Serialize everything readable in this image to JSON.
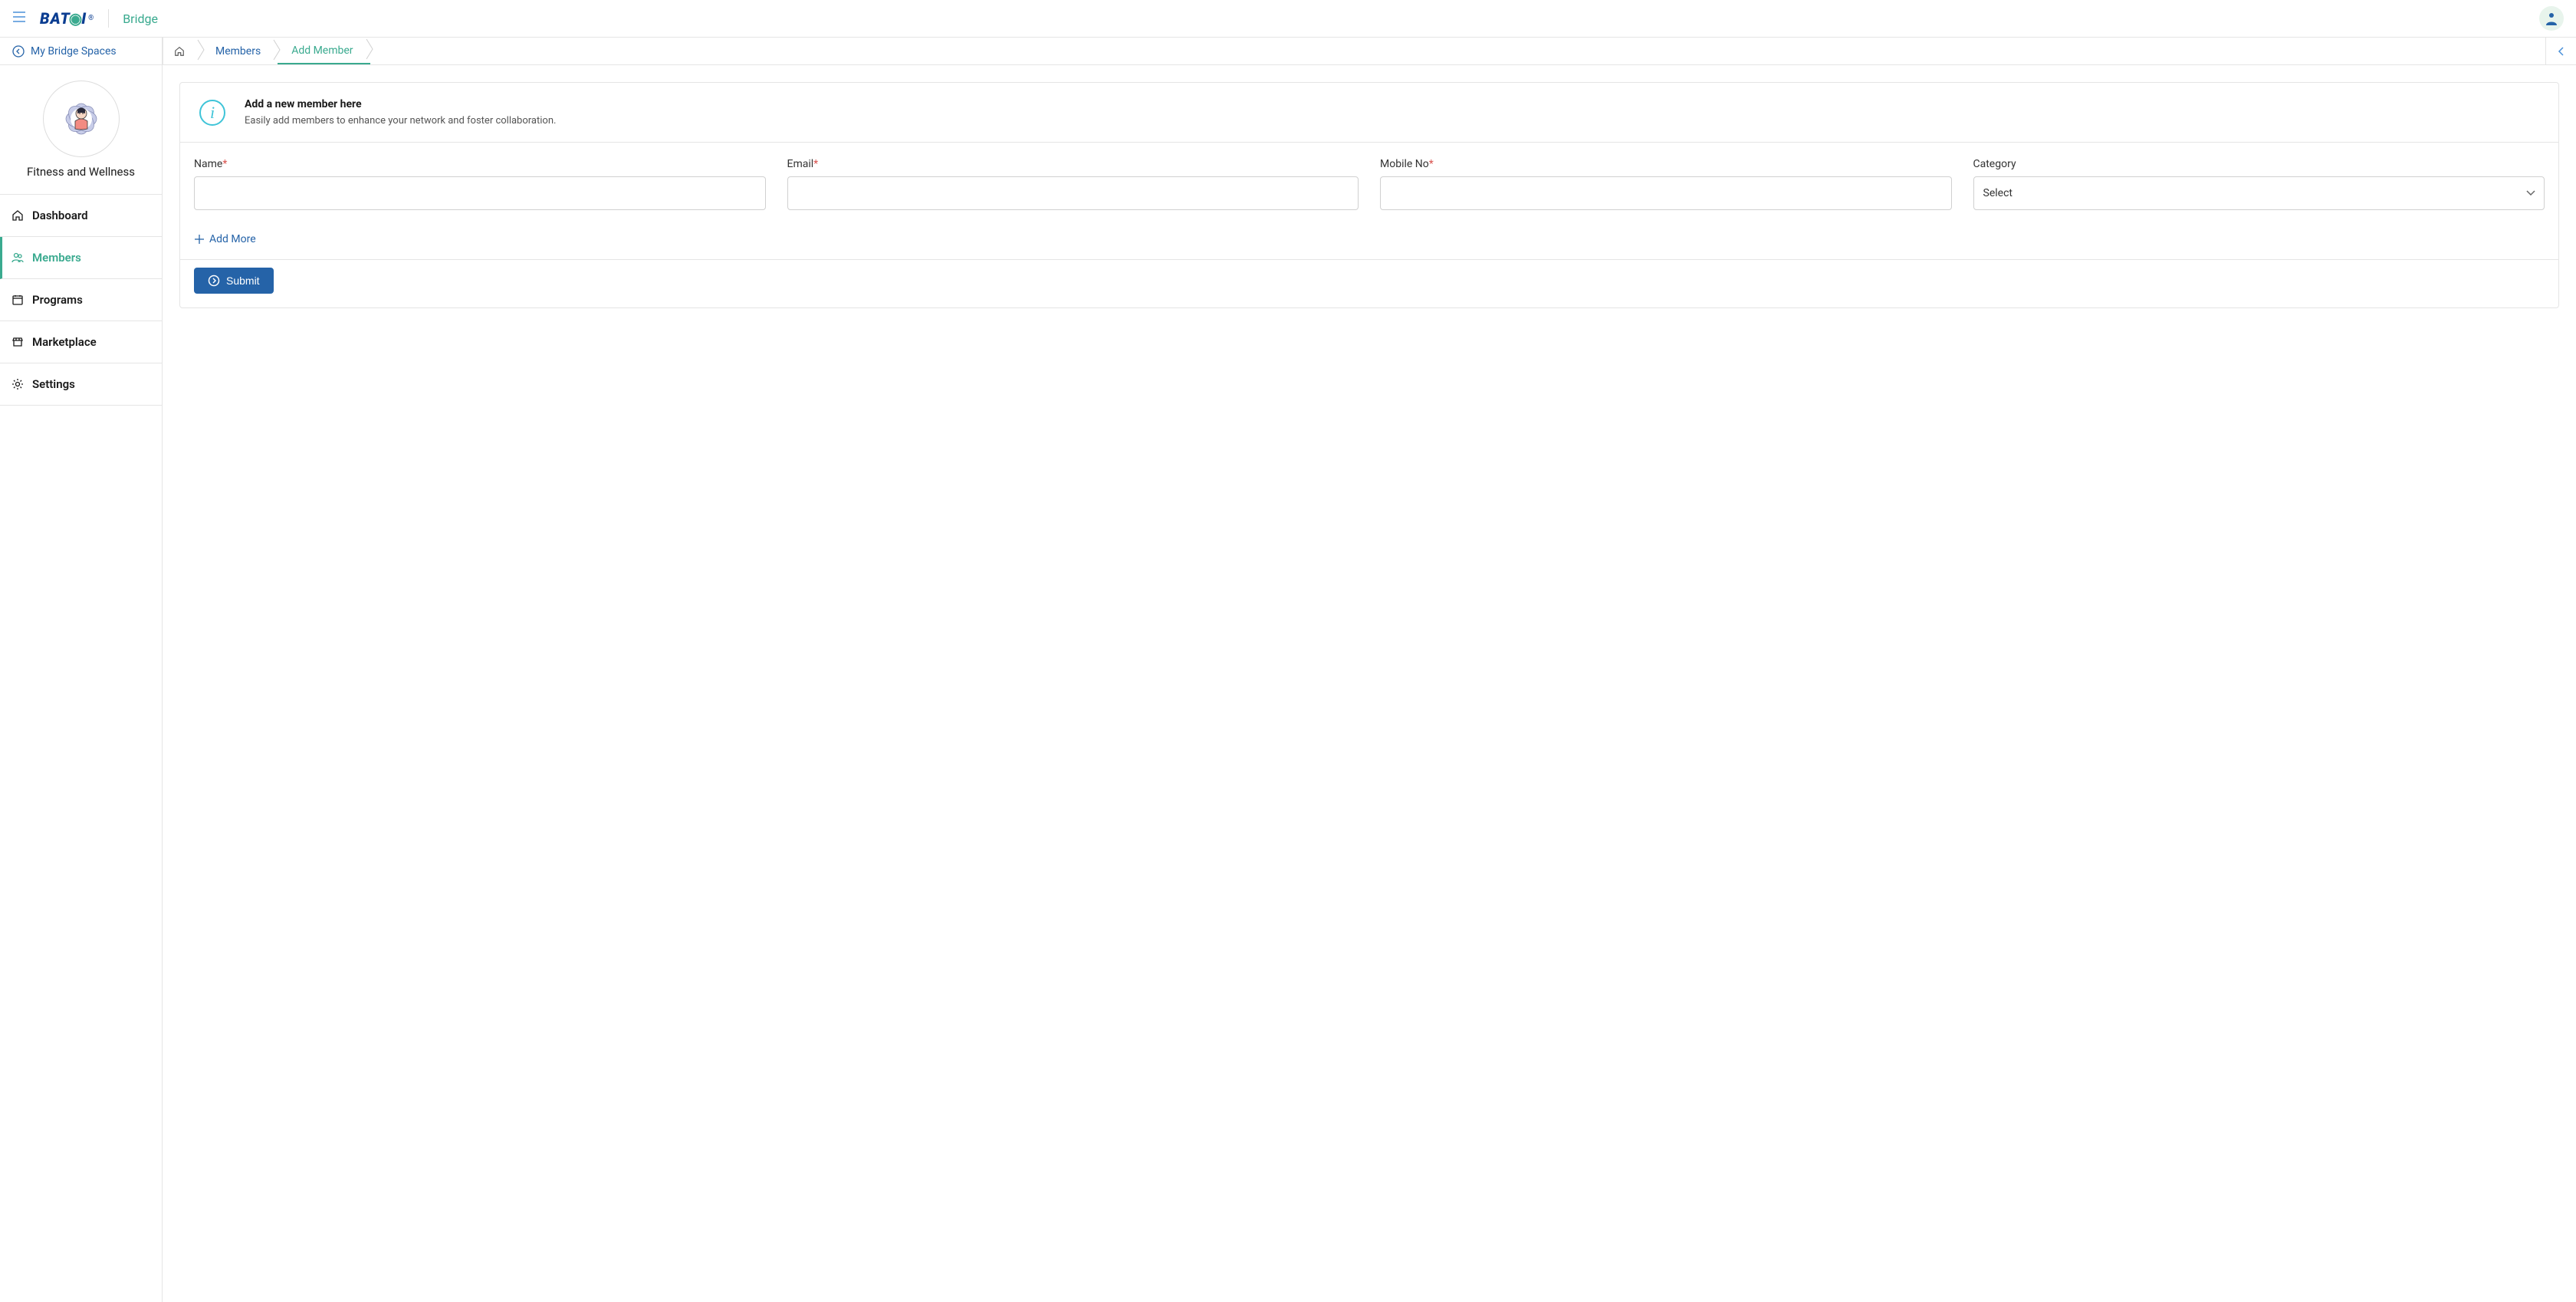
{
  "header": {
    "logo_text": "BAT",
    "logo_text_after": "I",
    "app_title": "Bridge"
  },
  "sidebar": {
    "back_label": "My Bridge Spaces",
    "space_name": "Fitness and Wellness",
    "items": [
      {
        "id": "dashboard",
        "label": "Dashboard",
        "icon": "home"
      },
      {
        "id": "members",
        "label": "Members",
        "icon": "users",
        "active": true
      },
      {
        "id": "programs",
        "label": "Programs",
        "icon": "calendar"
      },
      {
        "id": "marketplace",
        "label": "Marketplace",
        "icon": "store"
      },
      {
        "id": "settings",
        "label": "Settings",
        "icon": "gear"
      }
    ]
  },
  "breadcrumb": {
    "items": [
      {
        "id": "home",
        "label": "",
        "icon": "home"
      },
      {
        "id": "members",
        "label": "Members"
      },
      {
        "id": "add-member",
        "label": "Add Member",
        "active": true
      }
    ]
  },
  "card": {
    "title": "Add a new member here",
    "subtitle": "Easily add members to enhance your network and foster collaboration.",
    "add_more_label": "Add More",
    "submit_label": "Submit"
  },
  "form": {
    "fields": {
      "name": {
        "label": "Name",
        "required": true,
        "value": ""
      },
      "email": {
        "label": "Email",
        "required": true,
        "value": ""
      },
      "mobile": {
        "label": "Mobile No",
        "required": true,
        "value": ""
      },
      "category": {
        "label": "Category",
        "required": false,
        "placeholder": "Select"
      }
    }
  }
}
